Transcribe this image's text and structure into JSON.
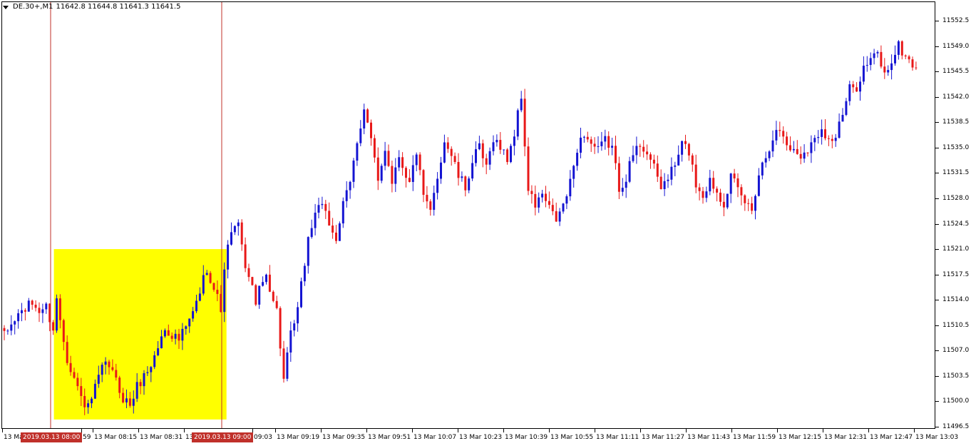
{
  "header": {
    "symbol": "DE.30+,M1",
    "ohlc": "11642.8 11644.8 11641.3 11641.5"
  },
  "colors": {
    "bull": "#1414d2",
    "bear": "#e81818",
    "highlight": "#ffff00",
    "vline": "#c0302a"
  },
  "price_axis": {
    "labels": [
      "11552.5",
      "11549.0",
      "11545.5",
      "11542.0",
      "11538.5",
      "11535.0",
      "11531.5",
      "11528.0",
      "11524.5",
      "11521.0",
      "11517.5",
      "11514.0",
      "11510.5",
      "11507.0",
      "11503.5",
      "11500.0",
      "11496.5"
    ]
  },
  "time_axis": {
    "labels": [
      "13 Mar",
      "59",
      "13 Mar 08:15",
      "13 Mar 08:31",
      "13",
      "09:03",
      "13 Mar 09:19",
      "13 Mar 09:35",
      "13 Mar 09:51",
      "13 Mar 10:07",
      "13 Mar 10:23",
      "13 Mar 10:39",
      "13 Mar 10:55",
      "13 Mar 11:11",
      "13 Mar 11:27",
      "13 Mar 11:43",
      "13 Mar 11:59",
      "13 Mar 12:15",
      "13 Mar 12:31",
      "13 Mar 12:47",
      "13 Mar 13:03"
    ]
  },
  "vertical_lines": [
    {
      "label": "2019.03.13 08:00"
    },
    {
      "label": "2019.03.13 09:00"
    }
  ],
  "highlight_box": {
    "price_top": 11521.0,
    "price_bottom": 11497.5
  },
  "chart_data": {
    "type": "candlestick",
    "timeframe": "M1",
    "ylim": [
      11495.0,
      11555.5
    ],
    "close_path": [
      [
        0,
        11509.0
      ],
      [
        4,
        11512.0
      ],
      [
        8,
        11513.5
      ],
      [
        10,
        11512.5
      ],
      [
        12,
        11513.0
      ],
      [
        14,
        11510.0
      ],
      [
        15,
        11514.0
      ],
      [
        18,
        11506.0
      ],
      [
        22,
        11500.5
      ],
      [
        24,
        11499.0
      ],
      [
        28,
        11504.5
      ],
      [
        30,
        11505.0
      ],
      [
        34,
        11500.5
      ],
      [
        36,
        11499.5
      ],
      [
        38,
        11502.0
      ],
      [
        42,
        11505.0
      ],
      [
        46,
        11510.0
      ],
      [
        50,
        11508.5
      ],
      [
        53,
        11511.0
      ],
      [
        55,
        11513.5
      ],
      [
        58,
        11518.5
      ],
      [
        60,
        11515.5
      ],
      [
        62,
        11513.0
      ],
      [
        64,
        11522.0
      ],
      [
        67,
        11524.5
      ],
      [
        68,
        11521.0
      ],
      [
        70,
        11517.0
      ],
      [
        72,
        11514.0
      ],
      [
        75,
        11517.5
      ],
      [
        78,
        11512.5
      ],
      [
        80,
        11503.0
      ],
      [
        82,
        11509.0
      ],
      [
        84,
        11512.5
      ],
      [
        87,
        11522.5
      ],
      [
        90,
        11527.5
      ],
      [
        92,
        11525.5
      ],
      [
        95,
        11522.5
      ],
      [
        97,
        11527.0
      ],
      [
        99,
        11530.0
      ],
      [
        101,
        11536.0
      ],
      [
        103,
        11540.5
      ],
      [
        105,
        11536.0
      ],
      [
        107,
        11530.0
      ],
      [
        109,
        11535.0
      ],
      [
        111,
        11530.5
      ],
      [
        113,
        11534.0
      ],
      [
        116,
        11530.0
      ],
      [
        118,
        11534.5
      ],
      [
        120,
        11528.0
      ],
      [
        122,
        11526.0
      ],
      [
        124,
        11531.0
      ],
      [
        126,
        11536.0
      ],
      [
        128,
        11534.0
      ],
      [
        130,
        11531.0
      ],
      [
        132,
        11529.5
      ],
      [
        134,
        11533.0
      ],
      [
        136,
        11535.0
      ],
      [
        138,
        11532.0
      ],
      [
        140,
        11536.5
      ],
      [
        142,
        11535.0
      ],
      [
        144,
        11533.5
      ],
      [
        146,
        11537.0
      ],
      [
        148,
        11542.0
      ],
      [
        150,
        11529.0
      ],
      [
        152,
        11527.0
      ],
      [
        154,
        11528.5
      ],
      [
        156,
        11526.5
      ],
      [
        158,
        11525.0
      ],
      [
        160,
        11527.0
      ],
      [
        162,
        11530.0
      ],
      [
        164,
        11535.0
      ],
      [
        166,
        11537.0
      ],
      [
        168,
        11535.5
      ],
      [
        170,
        11534.5
      ],
      [
        172,
        11536.0
      ],
      [
        174,
        11535.0
      ],
      [
        176,
        11529.5
      ],
      [
        178,
        11531.0
      ],
      [
        180,
        11534.0
      ],
      [
        182,
        11535.5
      ],
      [
        184,
        11534.5
      ],
      [
        186,
        11532.0
      ],
      [
        188,
        11529.5
      ],
      [
        190,
        11531.0
      ],
      [
        192,
        11532.5
      ],
      [
        194,
        11535.5
      ],
      [
        196,
        11534.5
      ],
      [
        198,
        11530.0
      ],
      [
        200,
        11528.5
      ],
      [
        202,
        11530.5
      ],
      [
        204,
        11529.0
      ],
      [
        206,
        11527.5
      ],
      [
        208,
        11531.0
      ],
      [
        210,
        11529.0
      ],
      [
        212,
        11527.5
      ],
      [
        214,
        11526.5
      ],
      [
        216,
        11531.5
      ],
      [
        218,
        11534.0
      ],
      [
        220,
        11536.5
      ],
      [
        222,
        11537.5
      ],
      [
        224,
        11535.5
      ],
      [
        226,
        11534.5
      ],
      [
        228,
        11534.0
      ],
      [
        230,
        11535.0
      ],
      [
        232,
        11536.0
      ],
      [
        234,
        11538.0
      ],
      [
        236,
        11536.0
      ],
      [
        238,
        11536.5
      ],
      [
        240,
        11539.5
      ],
      [
        242,
        11543.0
      ],
      [
        244,
        11543.5
      ],
      [
        246,
        11546.0
      ],
      [
        248,
        11547.0
      ],
      [
        250,
        11548.0
      ],
      [
        252,
        11545.0
      ],
      [
        254,
        11547.0
      ],
      [
        256,
        11549.0
      ],
      [
        258,
        11547.5
      ],
      [
        260,
        11546.5
      ],
      [
        261,
        11546.0
      ]
    ]
  }
}
